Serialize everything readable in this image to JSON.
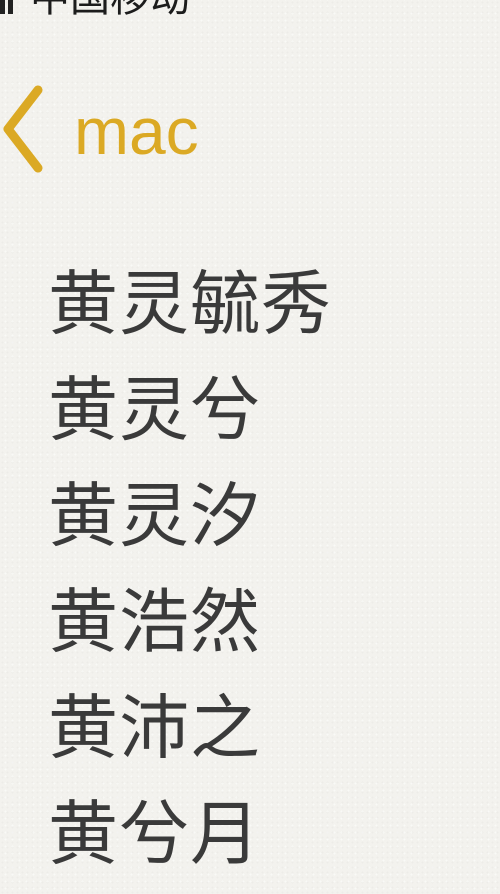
{
  "status_bar": {
    "carrier": "中国移动"
  },
  "nav": {
    "back_label": "mac",
    "accent_color": "#dba924"
  },
  "names": [
    "黄灵毓秀",
    "黄灵兮",
    "黄灵汐",
    "黄浩然",
    "黄沛之",
    "黄兮月"
  ]
}
